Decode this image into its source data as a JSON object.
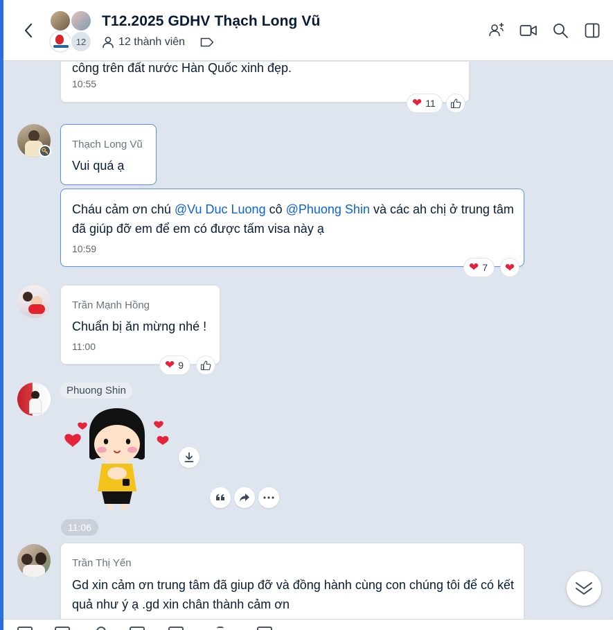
{
  "header": {
    "title": "T12.2025 GDHV Thạch Long Vũ",
    "avatar_count": "12",
    "members_label": "12 thành viên",
    "icons": [
      "back-icon",
      "add-member-icon",
      "video-call-icon",
      "search-icon",
      "sidebar-toggle-icon",
      "tag-icon",
      "person-icon"
    ]
  },
  "messages": {
    "m0": {
      "partial_text": "công trên đất nước Hàn Quốc xinh đẹp.",
      "time": "10:55",
      "reaction_count": "11"
    },
    "m1": {
      "sender": "Thạch Long Vũ",
      "text": "Vui quá ạ"
    },
    "m2": {
      "text_before": "Cháu cảm ơn chú ",
      "mention1": "@Vu Duc Luong",
      "text_mid": " cô ",
      "mention2": "@Phuong Shin",
      "text_after": " và các ah chị ở trung tâm đã giúp đỡ em để em có được tấm visa này ạ",
      "time": "10:59",
      "reaction_count": "7"
    },
    "m3": {
      "sender": "Trần Mạnh Hồng",
      "text": "Chuẩn bị ăn mừng nhé !",
      "time": "11:00",
      "reaction_count": "9"
    },
    "m4": {
      "sender": "Phuong Shin",
      "time": "11:06",
      "sticker": "girl-sticker-with-hearts"
    },
    "m5": {
      "sender": "Trần Thị Yến",
      "text": "Gd xin cảm ơn trung tâm đã giup đỡ và đồng hành cùng con chúng  tôi để có kết quả như ý ạ .gd xin chân thành cảm ơn"
    }
  },
  "colors": {
    "accent": "#0a64d8",
    "heart": "#e3243b",
    "outline": "#5f95e0"
  }
}
